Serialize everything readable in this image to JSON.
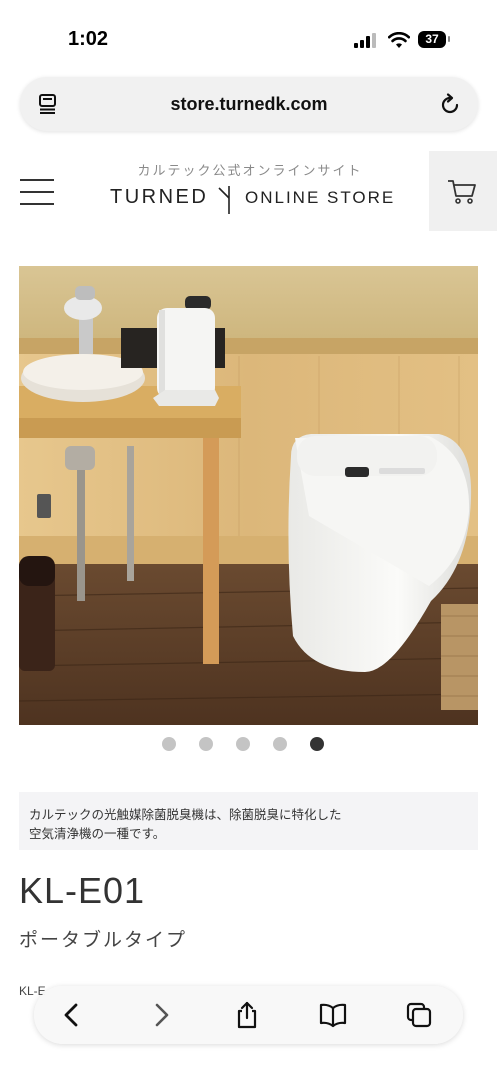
{
  "status_bar": {
    "time": "1:02",
    "battery": "37",
    "icons": [
      "cellular-signal-icon",
      "wifi-icon",
      "battery-icon"
    ]
  },
  "browser": {
    "url": "store.turnedk.com",
    "icons": [
      "reader-mode-icon",
      "reload-icon"
    ]
  },
  "header": {
    "subtitle": "カルテック公式オンラインサイト",
    "brand": "TURNED",
    "brand_store": "ONLINE STORE",
    "icons": [
      "menu-icon",
      "cart-icon"
    ]
  },
  "carousel": {
    "slide_count": 5,
    "active_index": 4
  },
  "product": {
    "description_line1": "カルテックの光触媒除菌脱臭機は、除菌脱臭に特化した",
    "description_line2": "空気清浄機の一種です。",
    "code": "KL-E01",
    "type": "ポータブルタイプ",
    "spec_peek": "KL-E"
  },
  "toolbar": {
    "icons": [
      "back-icon",
      "forward-icon",
      "share-icon",
      "bookmarks-icon",
      "tabs-icon"
    ]
  },
  "colors": {
    "accent_dark": "#333333",
    "desc_bg": "#f4f4f6",
    "cart_bg": "#f0f0f0"
  }
}
